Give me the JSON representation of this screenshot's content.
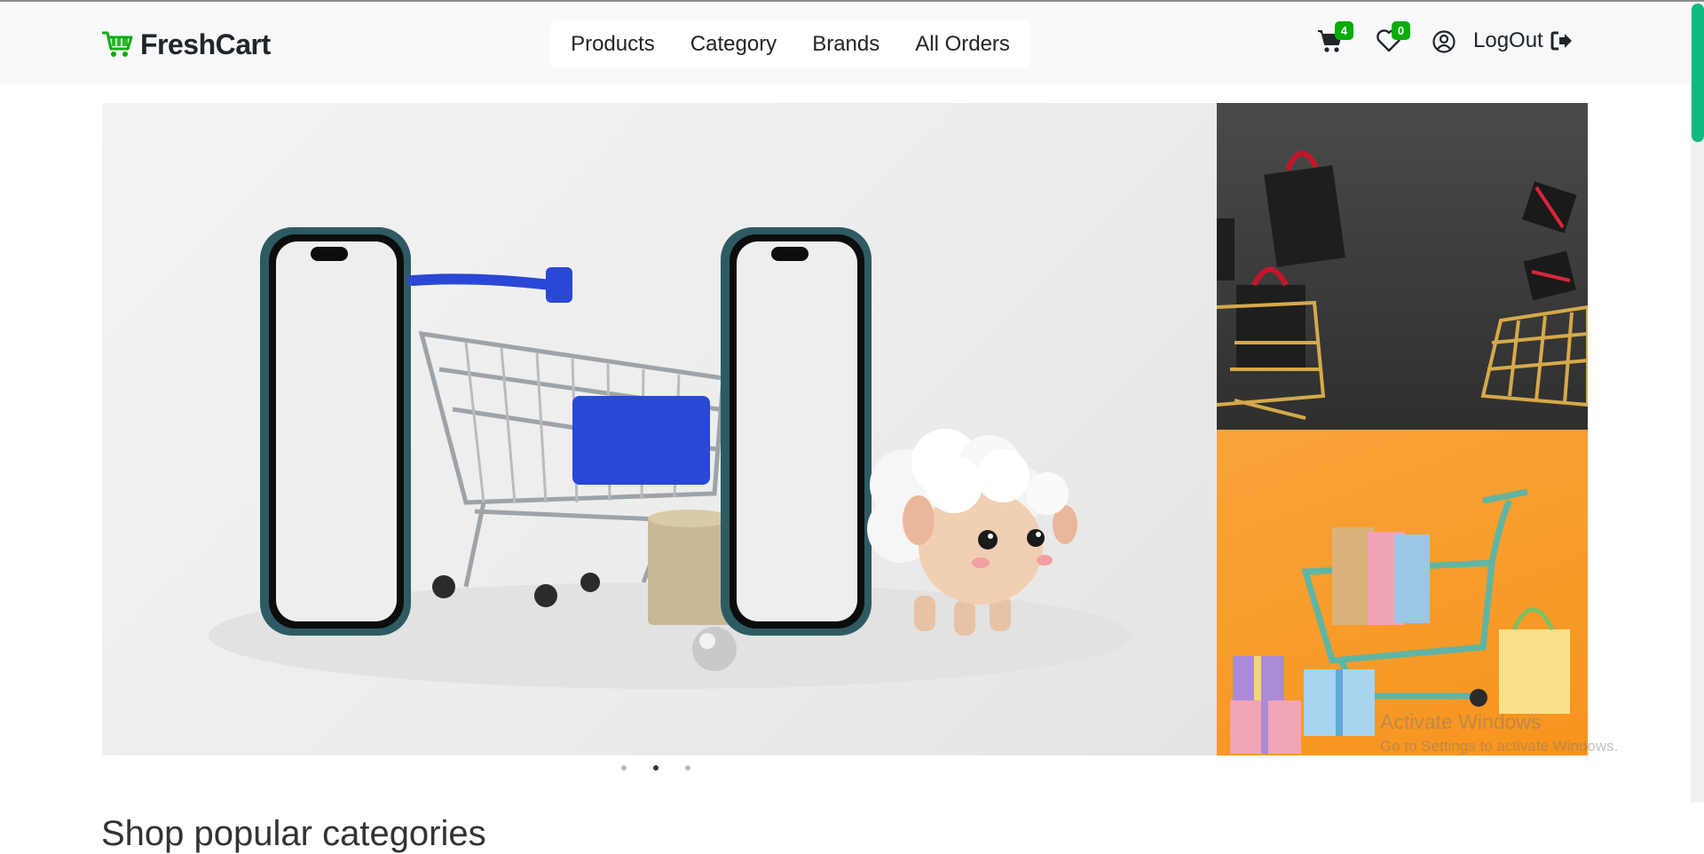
{
  "brand": {
    "name": "FreshCart",
    "logo_icon": "shopping-cart-icon",
    "accent": "#0aad0a"
  },
  "nav": {
    "links": [
      "Products",
      "Category",
      "Brands",
      "All Orders"
    ]
  },
  "header_actions": {
    "cart_count": "4",
    "wishlist_count": "0",
    "logout_label": "LogOut",
    "badge_color": "#0aad0a"
  },
  "slider": {
    "main_image": "phones-shopping-cart-sheep",
    "side_images": [
      "black-gift-bags-golden-carts",
      "orange-cart-gift-boxes"
    ],
    "dots_total": 3,
    "active_dot": 2
  },
  "section": {
    "title": "Shop popular categories"
  },
  "os_overlay": {
    "line1": "Activate Windows",
    "line2": "Go to Settings to activate Windows."
  }
}
